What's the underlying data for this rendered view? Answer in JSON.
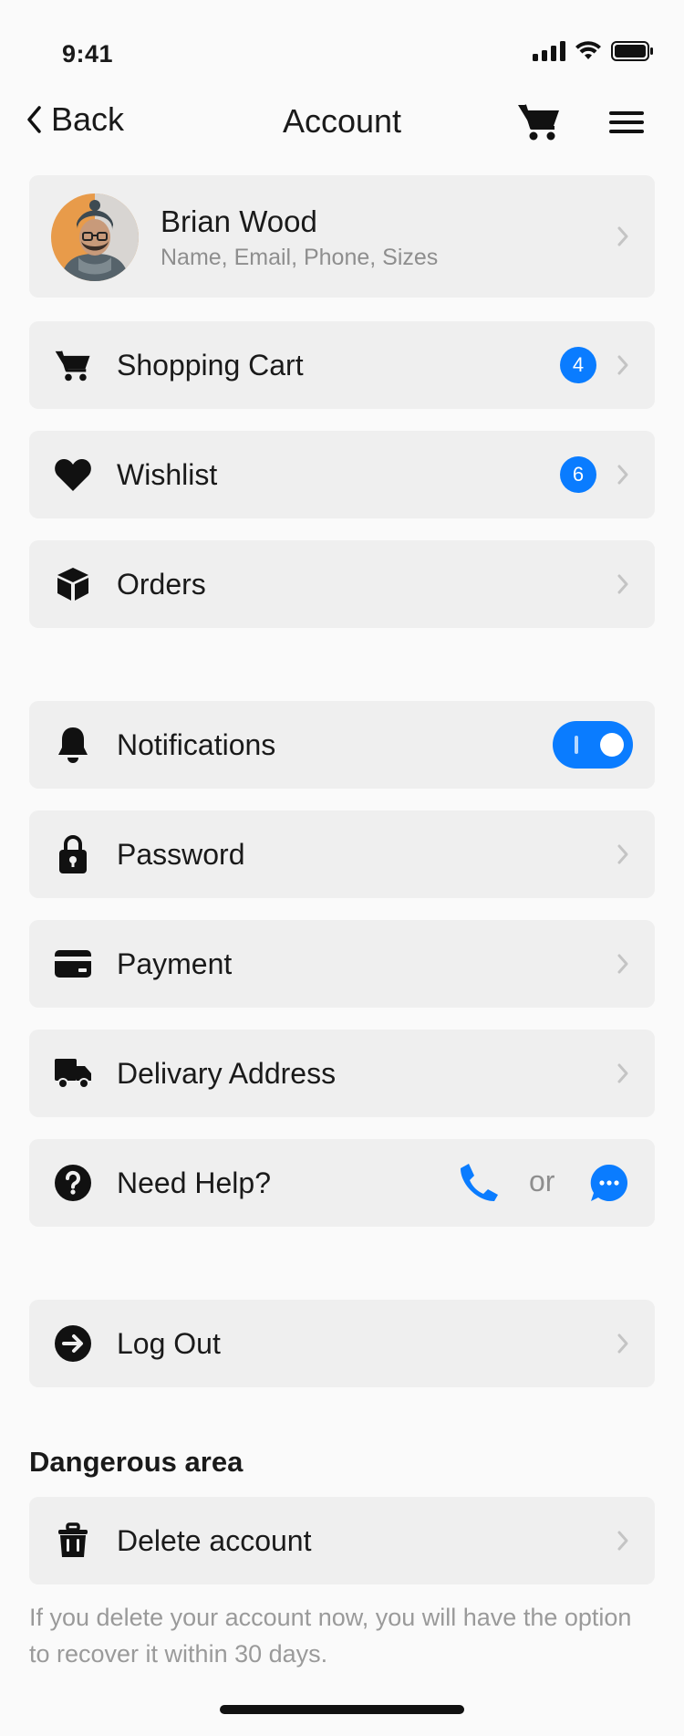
{
  "status_bar": {
    "time": "9:41"
  },
  "nav": {
    "back_label": "Back",
    "title": "Account"
  },
  "profile": {
    "name": "Brian Wood",
    "subtitle": "Name, Email, Phone, Sizes"
  },
  "menu": {
    "shopping_cart": {
      "label": "Shopping Cart",
      "badge": "4"
    },
    "wishlist": {
      "label": "Wishlist",
      "badge": "6"
    },
    "orders": {
      "label": "Orders"
    },
    "notifications": {
      "label": "Notifications",
      "enabled": true
    },
    "password": {
      "label": "Password"
    },
    "payment": {
      "label": "Payment"
    },
    "delivery": {
      "label": "Delivary Address"
    },
    "help": {
      "label": "Need Help?",
      "or_text": "or"
    },
    "logout": {
      "label": "Log Out"
    }
  },
  "danger": {
    "title": "Dangerous area",
    "delete_label": "Delete account",
    "note": "If you delete your account now, you will have the option to recover it within 30 days."
  },
  "colors": {
    "accent": "#0a7cff",
    "card_bg": "#efefef",
    "muted_text": "#8e8e8e"
  },
  "icons": [
    "cart-icon",
    "heart-icon",
    "box-icon",
    "bell-icon",
    "lock-icon",
    "card-icon",
    "truck-icon",
    "help-icon",
    "phone-icon",
    "chat-icon",
    "logout-icon",
    "trash-icon",
    "menu-icon"
  ]
}
